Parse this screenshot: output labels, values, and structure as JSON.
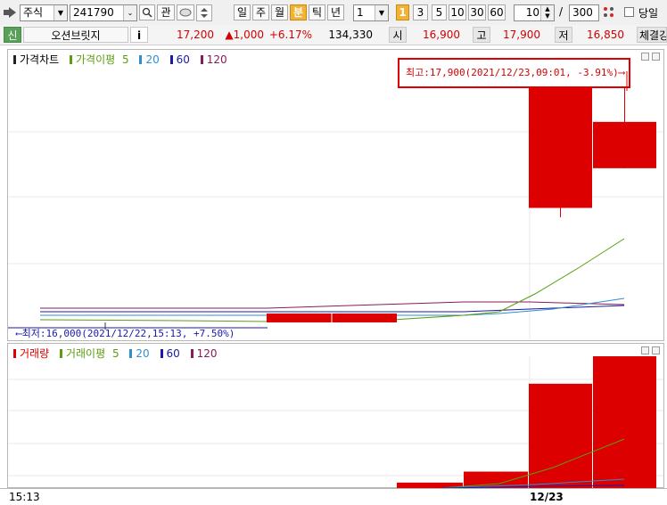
{
  "toolbar": {
    "market_type": "주식",
    "stock_code": "241790",
    "interest_label": "관",
    "period_buttons": [
      "일",
      "주",
      "월",
      "분",
      "틱",
      "년"
    ],
    "selected_period": "분",
    "interval_value": "1",
    "interval_buttons": [
      "1",
      "3",
      "5",
      "10",
      "30",
      "60"
    ],
    "selected_interval": "1",
    "display_count": "10",
    "total_count": "300",
    "count_separator": "/",
    "today_only_label": "당일"
  },
  "quote": {
    "badge": "신",
    "name": "오션브릿지",
    "info_label": "i",
    "price": "17,200",
    "change": "▲1,000",
    "change_rate": "+6.17%",
    "volume": "134,330",
    "open_label": "시",
    "open": "16,900",
    "high_label": "고",
    "high": "17,900",
    "low_label": "저",
    "low": "16,850",
    "strength_label": "체결강"
  },
  "price_panel": {
    "title": "가격차트",
    "ma_label": "가격이평",
    "ma_periods": [
      "5",
      "20",
      "60",
      "120"
    ],
    "high_annotation": "최고:17,900(2021/12/23,09:01, -3.91%)⟶",
    "low_annotation": "⟵최저:16,000(2021/12/22,15:13, +7.50%)"
  },
  "volume_panel": {
    "title": "거래량",
    "ma_label": "거래이평",
    "ma_periods": [
      "5",
      "20",
      "60",
      "120"
    ]
  },
  "time_axis": {
    "start_label": "15:13",
    "date_label": "12/23"
  },
  "colors": {
    "up": "#dd0000",
    "ma5": "#5a9e10",
    "ma20": "#2f8fd0",
    "ma60": "#1a1aa8",
    "ma120": "#8a1a5a"
  },
  "chart_data": {
    "type": "candlestick",
    "candles": [
      {
        "open": 16900,
        "high": 17000,
        "low": 16830,
        "close": 17850
      },
      {
        "open": 17550,
        "high": 17900,
        "low": 17200,
        "close": 17200
      }
    ],
    "price_range": [
      15900,
      18000
    ],
    "volume_bars": [
      1,
      3,
      19,
      24
    ],
    "marker_high": 17900,
    "marker_low": 16000
  }
}
